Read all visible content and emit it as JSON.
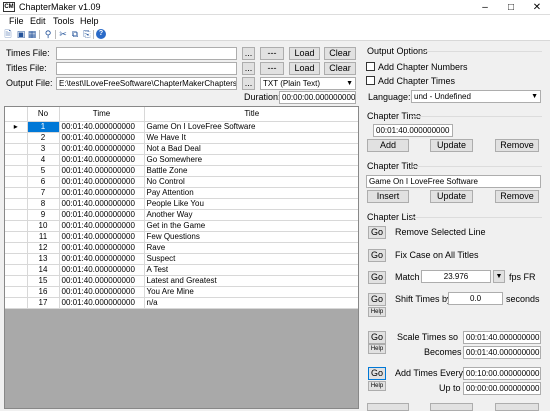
{
  "window": {
    "title": "ChapterMaker v1.09",
    "icon_text": "CM"
  },
  "menu": [
    "File",
    "Edit",
    "Tools",
    "Help"
  ],
  "toolbar_icons": [
    "new-file-icon",
    "save-icon",
    "save-as-icon",
    "find-icon",
    "cut-icon",
    "copy-icon",
    "paste-icon",
    "help-icon"
  ],
  "files": {
    "times_label": "Times File:",
    "titles_label": "Titles File:",
    "output_label": "Output File:",
    "times_value": "",
    "titles_value": "",
    "output_value": "E:\\test\\ILoveFreeSoftware\\ChapterMakerChapters.txt",
    "browse": "...",
    "dash_button": "---",
    "load": "Load",
    "clear": "Clear",
    "format": "TXT (Plain Text)",
    "duration_label": "Duration:",
    "duration_value": "00:00:00.000000000"
  },
  "grid": {
    "columns": [
      "No",
      "Time",
      "Title"
    ],
    "rows": [
      {
        "no": "1",
        "time": "00:01:40.000000000",
        "title": "Game On I LoveFree Software"
      },
      {
        "no": "2",
        "time": "00:01:40.000000000",
        "title": "We Have It"
      },
      {
        "no": "3",
        "time": "00:01:40.000000000",
        "title": "Not a Bad Deal"
      },
      {
        "no": "4",
        "time": "00:01:40.000000000",
        "title": "Go Somewhere"
      },
      {
        "no": "5",
        "time": "00:01:40.000000000",
        "title": "Battle Zone"
      },
      {
        "no": "6",
        "time": "00:01:40.000000000",
        "title": "No Control"
      },
      {
        "no": "7",
        "time": "00:01:40.000000000",
        "title": "Pay Attention"
      },
      {
        "no": "8",
        "time": "00:01:40.000000000",
        "title": "People Like You"
      },
      {
        "no": "9",
        "time": "00:01:40.000000000",
        "title": "Another Way"
      },
      {
        "no": "10",
        "time": "00:01:40.000000000",
        "title": "Get in the Game"
      },
      {
        "no": "11",
        "time": "00:01:40.000000000",
        "title": "Few Questions"
      },
      {
        "no": "12",
        "time": "00:01:40.000000000",
        "title": "Rave"
      },
      {
        "no": "13",
        "time": "00:01:40.000000000",
        "title": "Suspect"
      },
      {
        "no": "14",
        "time": "00:01:40.000000000",
        "title": "A Test"
      },
      {
        "no": "15",
        "time": "00:01:40.000000000",
        "title": "Latest and Greatest"
      },
      {
        "no": "16",
        "time": "00:01:40.000000000",
        "title": "You Are Mine"
      },
      {
        "no": "17",
        "time": "00:01:40.000000000",
        "title": "n/a"
      }
    ]
  },
  "output_options": {
    "heading": "Output Options",
    "add_numbers": "Add Chapter Numbers",
    "add_times": "Add Chapter Times",
    "language_label": "Language:",
    "language_value": "und - Undefined"
  },
  "chapter_time": {
    "heading": "Chapter Time",
    "value": "00:01:40.000000000",
    "add": "Add",
    "update": "Update",
    "remove": "Remove"
  },
  "chapter_title": {
    "heading": "Chapter Title",
    "value": "Game On I LoveFree Software",
    "insert": "Insert",
    "update": "Update",
    "remove": "Remove"
  },
  "chapter_list": {
    "heading": "Chapter List",
    "go": "Go",
    "help": "Help",
    "remove_selected": "Remove Selected Line",
    "fix_case": "Fix Case on All Titles",
    "match_label": "Match",
    "fps_value": "23.976",
    "fps_label": "fps FR",
    "shift_label": "Shift Times by",
    "shift_value": "0.0",
    "seconds_label": "seconds",
    "scale_label": "Scale Times so",
    "scale_value": "00:01:40.000000000",
    "becomes_label": "Becomes",
    "becomes_value": "00:01:40.000000000",
    "add_every_label": "Add Times Every",
    "add_every_value": "00:10:00.000000000",
    "up_to_label": "Up to",
    "up_to_value": "00:00:00.000000000"
  }
}
